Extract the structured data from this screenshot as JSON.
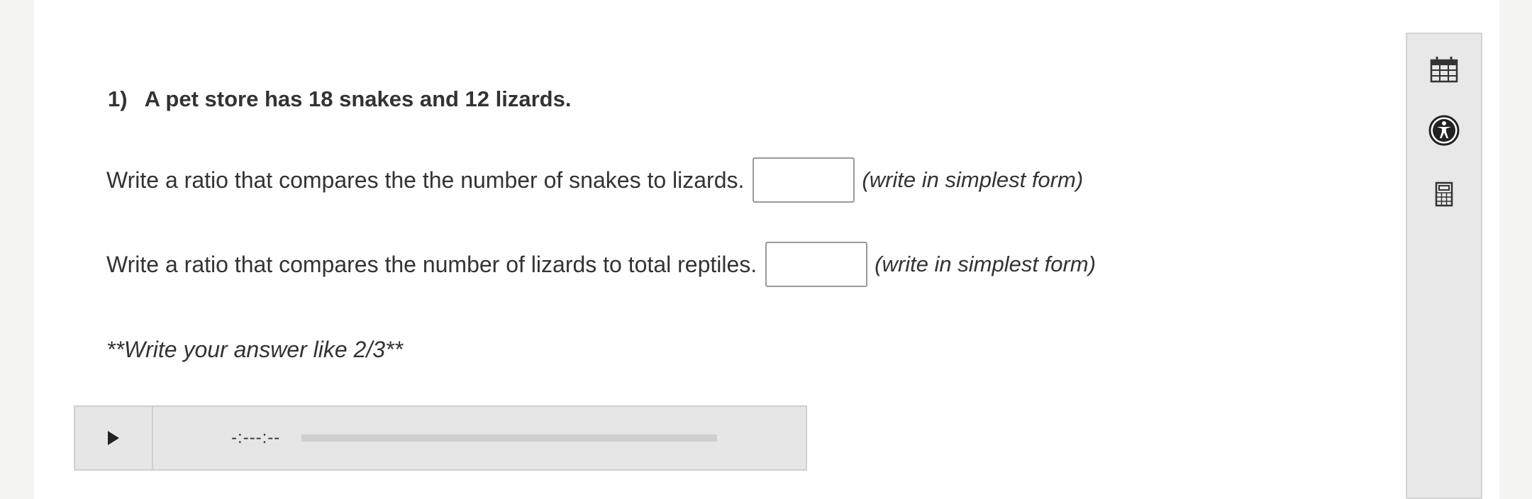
{
  "question": {
    "number": "1)",
    "title": "A pet store has 18 snakes and 12 lizards."
  },
  "prompts": [
    {
      "text": "Write a ratio that compares the the number of snakes to lizards.",
      "answer_value": "",
      "hint": "(write in simplest form)"
    },
    {
      "text": "Write a ratio that compares the number of lizards to total reptiles.",
      "answer_value": "",
      "hint": "(write in simplest form)"
    }
  ],
  "note": "**Write your answer like 2/3**",
  "audio": {
    "play_icon": "play-icon",
    "time": "-:---:--",
    "progress": 0
  },
  "tools": [
    {
      "icon": "calendar-icon"
    },
    {
      "icon": "accessibility-icon"
    },
    {
      "icon": "calculator-icon"
    }
  ],
  "colors": {
    "background": "#f4f4f2",
    "card": "#ffffff",
    "panel": "#e8e8e8",
    "text": "#333333"
  }
}
